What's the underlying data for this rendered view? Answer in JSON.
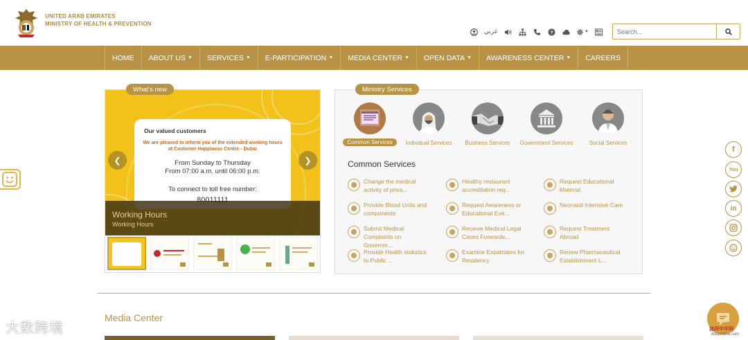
{
  "header": {
    "ministry_line1": "UNITED ARAB EMIRATES",
    "ministry_line2": "MINISTRY OF HEALTH & PREVENTION",
    "arabic_toggle": "عربي",
    "search_placeholder": "Search..."
  },
  "nav": {
    "items": [
      {
        "label": "HOME",
        "dropdown": false
      },
      {
        "label": "ABOUT US",
        "dropdown": true
      },
      {
        "label": "SERVICES",
        "dropdown": true
      },
      {
        "label": "E-PARTICIPATION",
        "dropdown": true
      },
      {
        "label": "MEDIA CENTER",
        "dropdown": true
      },
      {
        "label": "OPEN DATA",
        "dropdown": true
      },
      {
        "label": "AWARENESS CENTER",
        "dropdown": true
      },
      {
        "label": "CAREERS",
        "dropdown": false
      }
    ]
  },
  "whats_new": {
    "tab_label": "What's new",
    "notice_title": "Our valued customers",
    "notice_sub": "We are pleased to inform you of the extended working hours at Customer Happiness Centre - Dubai",
    "notice_days": "From Sunday to Thursday",
    "notice_hours": "From 07:00 a.m. until 06:00 p.m.",
    "notice_connect": "To connect to toll free number:",
    "notice_number": "80011111",
    "caption_title": "Working Hours",
    "caption_sub": "Working Hours"
  },
  "ministry_services": {
    "tab_label": "Ministry Services",
    "categories": [
      {
        "label": "Common Services",
        "active": true
      },
      {
        "label": "Individual Services",
        "active": false
      },
      {
        "label": "Business Services",
        "active": false
      },
      {
        "label": "Government Services",
        "active": false
      },
      {
        "label": "Social Services",
        "active": false
      }
    ],
    "section_title": "Common Services",
    "items": [
      {
        "line1": "Change the medical",
        "line2": "activity of priva..."
      },
      {
        "line1": "Healthy restaurant",
        "line2": "accreditation req..."
      },
      {
        "line1": "Request Educational",
        "line2": "Material"
      },
      {
        "line1": "Provide Blood Units and",
        "line2": "components"
      },
      {
        "line1": "Request Awareness or",
        "line2": "Educational Eve..."
      },
      {
        "line1": "Neonatal Intensive Care",
        "line2": ""
      },
      {
        "line1": "Submit Medical",
        "line2": "Complaints on",
        "line3": "Governm..."
      },
      {
        "line1": "Receive Medical Legal",
        "line2": "Cases Forwarde..."
      },
      {
        "line1": "Request Treatment",
        "line2": "Abroad"
      },
      {
        "line1": "Provide Health statistics",
        "line2": "to Public ..."
      },
      {
        "line1": "Examine Expatriates for",
        "line2": "Residency"
      },
      {
        "line1": "Renew Pharmaceutical",
        "line2": "Establishment L..."
      }
    ]
  },
  "media_center": {
    "title": "Media Center"
  },
  "social": [
    "facebook-icon",
    "youtube-icon",
    "twitter-icon",
    "linkedin-icon",
    "instagram-icon",
    "smile-icon"
  ],
  "social_labels": {
    "facebook": "f",
    "youtube": "You",
    "linkedin": "in"
  },
  "watermarks": {
    "left": "大数跨境",
    "right": "迪拜中华网",
    "right_url": "dibaichina.com"
  },
  "colors": {
    "gold": "#b89245",
    "yellow": "#f2c21b"
  }
}
